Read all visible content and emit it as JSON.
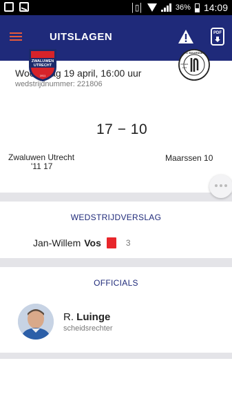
{
  "status_bar": {
    "battery": "36%",
    "time": "14:09",
    "icons": [
      "screenshot-icon",
      "mail-icon",
      "vibrate-icon",
      "wifi-icon",
      "signal-icon",
      "battery-icon"
    ]
  },
  "app_bar": {
    "title": "UITSLAGEN",
    "menu_icon": "hamburger-icon",
    "warning_icon": "warning-icon",
    "pdf_label": "PDF",
    "accent": "#e85a3a",
    "background": "#1f2a7a"
  },
  "match": {
    "date": "Woensdag 19 april, 16:00 uur",
    "match_number": "wedstrijdnummer: 221806",
    "score": "17 − 10",
    "home_team_line1": "Zwaluwen Utrecht",
    "home_team_line2": "'11 17",
    "away_team": "Maarssen 10",
    "home_logo": {
      "line1": "ZWALUWEN",
      "line2": "UTRECHT",
      "year": "1911"
    },
    "away_logo": {
      "arc_text": "V.V. MAARSSEN",
      "left_text": "OPGER.",
      "left_year": "1921"
    }
  },
  "report": {
    "title": "WEDSTRIJDVERSLAG",
    "events": [
      {
        "first_name": "Jan-Willem",
        "last_name": "Vos",
        "card": "red",
        "minute": "3"
      }
    ]
  },
  "officials": {
    "title": "OFFICIALS",
    "people": [
      {
        "first_name": "R.",
        "last_name": "Luinge",
        "role": "scheidsrechter"
      }
    ]
  }
}
